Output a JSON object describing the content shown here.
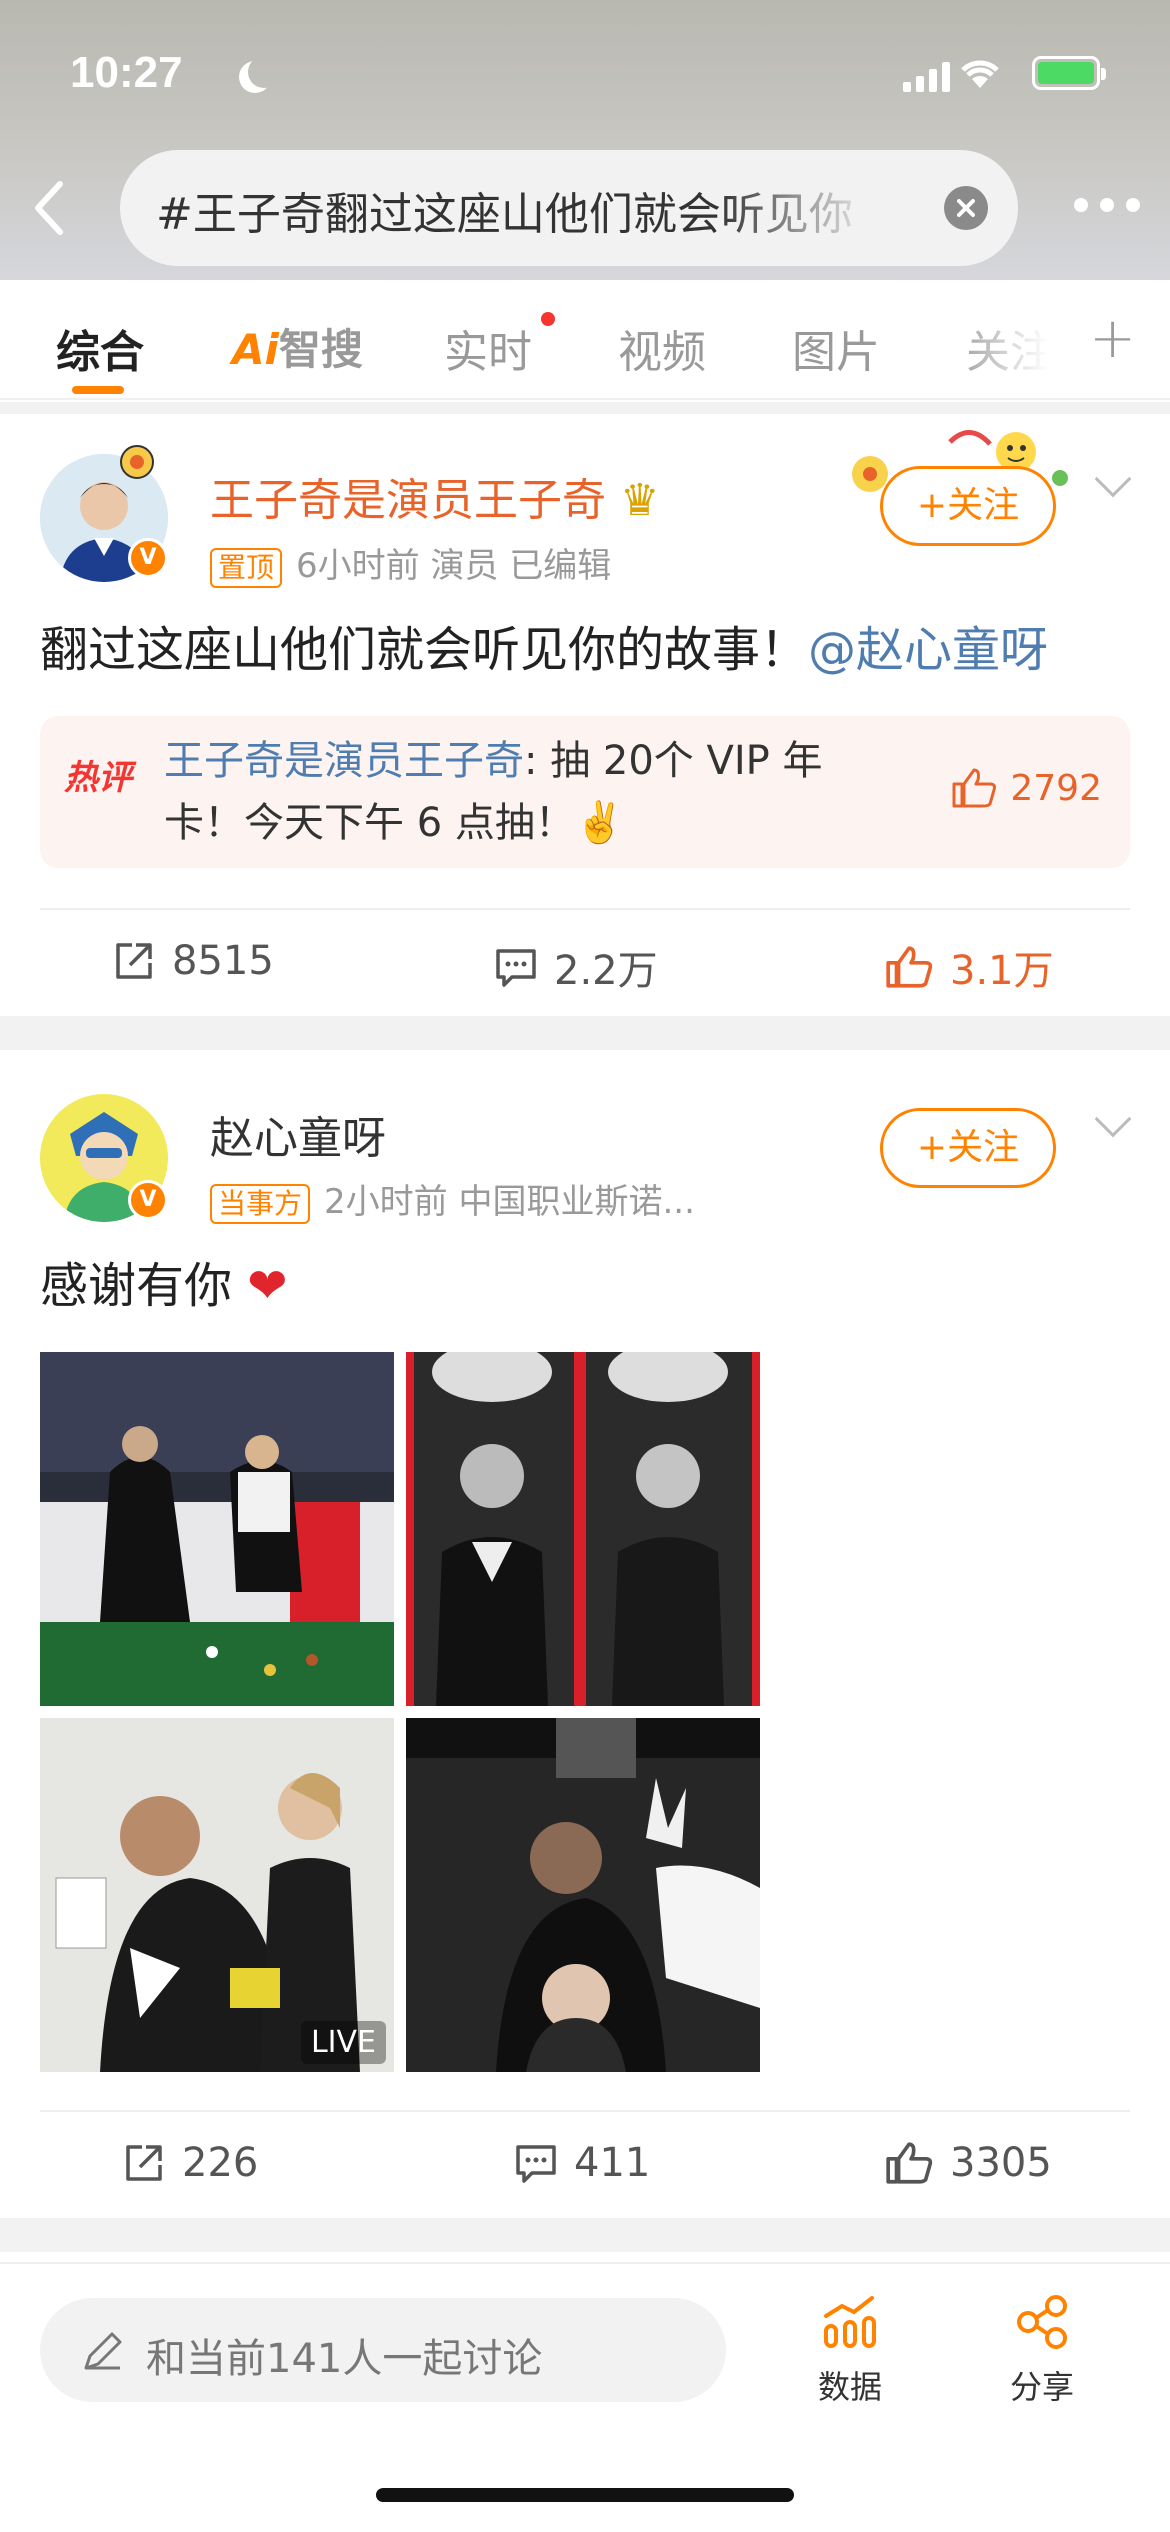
{
  "status_bar": {
    "time": "10:27"
  },
  "search": {
    "query": "#王子奇翻过这座山他们就会听见你"
  },
  "tabs": [
    {
      "label": "综合"
    },
    {
      "label_a": "Ai",
      "label_b": "智搜"
    },
    {
      "label": "实时"
    },
    {
      "label": "视频"
    },
    {
      "label": "图片"
    },
    {
      "label": "关注"
    }
  ],
  "posts": [
    {
      "user": "王子奇是演员王子奇",
      "tag": "置顶",
      "meta": "6小时前  演员  已编辑",
      "follow": "+关注",
      "text": "翻过这座山他们就会听见你的故事！",
      "mention": "@赵心童呀",
      "hot_comment": {
        "logo": "热评",
        "user": "王子奇是演员王子奇",
        "text": ": 抽 20个 VIP 年卡！今天下午 6 点抽！✌️",
        "likes": "2792"
      },
      "shares": "8515",
      "comments": "2.2万",
      "likes": "3.1万"
    },
    {
      "user": "赵心童呀",
      "tag": "当事方",
      "meta": "2小时前  中国职业斯诺...",
      "follow": "+关注",
      "text": "感谢有你",
      "live_label": "LIVE",
      "shares": "226",
      "comments": "411",
      "likes": "3305"
    }
  ],
  "bottom_bar": {
    "input_placeholder": "和当前141人一起讨论",
    "data_label": "数据",
    "share_label": "分享"
  },
  "colors": {
    "accent": "#ff8200",
    "link": "#507daf",
    "like": "#e8632a"
  }
}
